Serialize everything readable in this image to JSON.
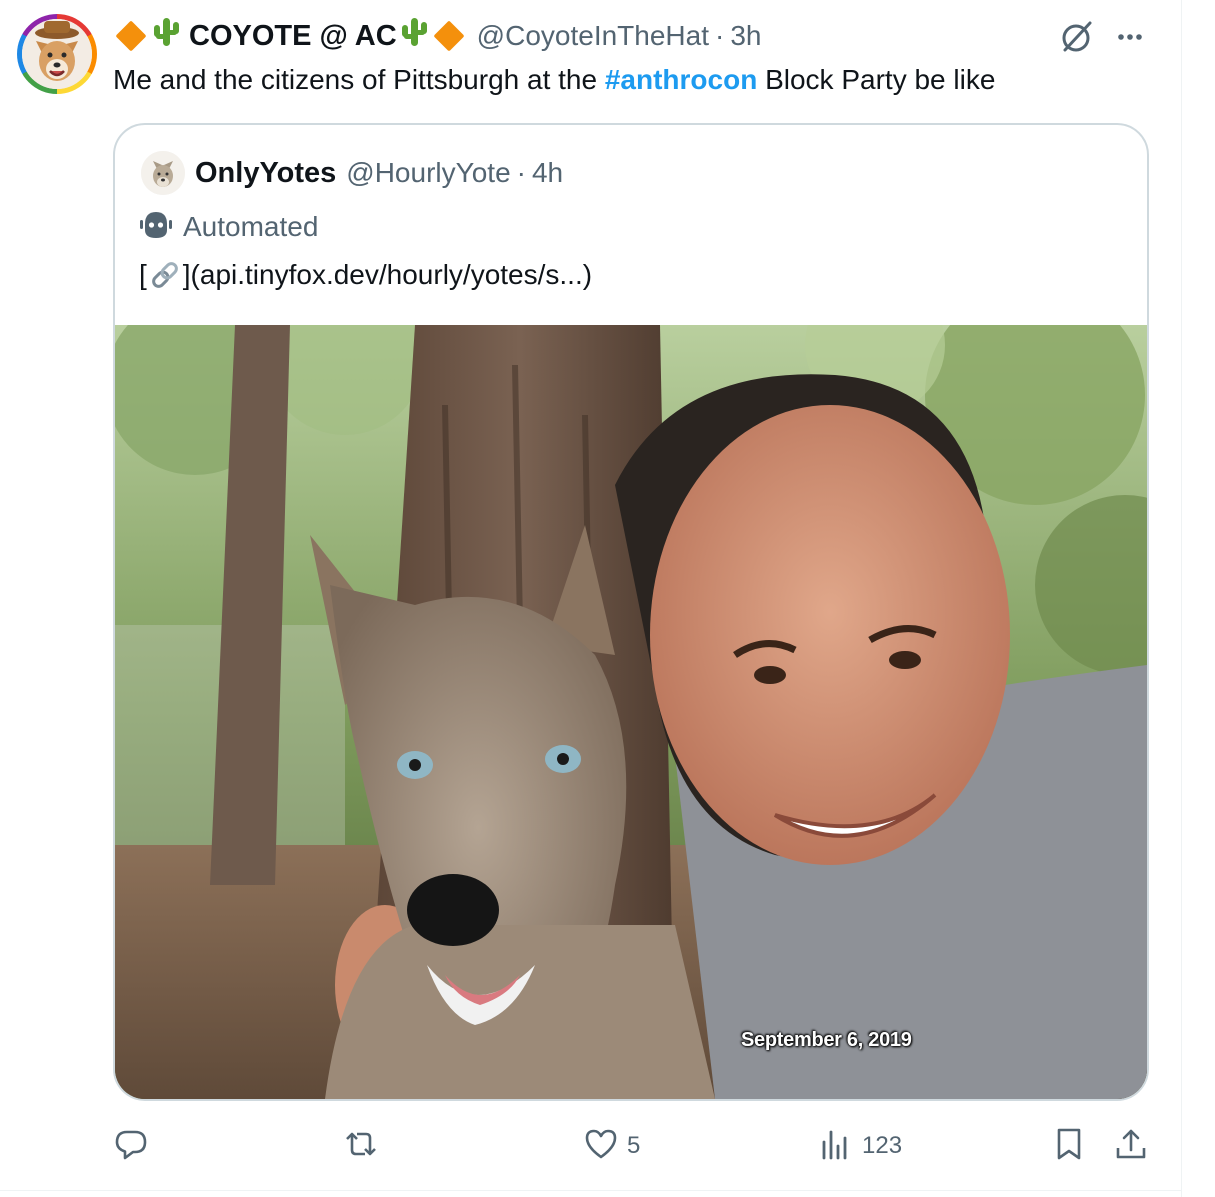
{
  "tweet": {
    "author": {
      "display_name": "COYOTE @ AC",
      "handle": "@CoyoteInTheHat",
      "separator": "·",
      "time": "3h",
      "avatar_icon": "coyote-avatar-icon"
    },
    "text_before": "Me and the citizens of Pittsburgh at the ",
    "hashtag": "#anthrocon",
    "text_after": " Block Party be like",
    "hashtag_color": "#1d9bf0"
  },
  "quote": {
    "author": {
      "display_name": "OnlyYotes",
      "handle": "@HourlyYote",
      "separator": "·",
      "time": "4h"
    },
    "automated_label": "Automated",
    "text_prefix": "[",
    "text_link": "](api.tinyfox.dev/hourly/yotes/s...)",
    "photo": {
      "date_stamp": "September 6, 2019"
    }
  },
  "actions": {
    "reply_count": "",
    "retweet_count": "",
    "like_count": "5",
    "views_count": "123"
  },
  "colors": {
    "text": "#0f1419",
    "muted": "#536471",
    "border": "#cfd9de",
    "accent": "#1d9bf0",
    "diamond": "#f4900c"
  }
}
